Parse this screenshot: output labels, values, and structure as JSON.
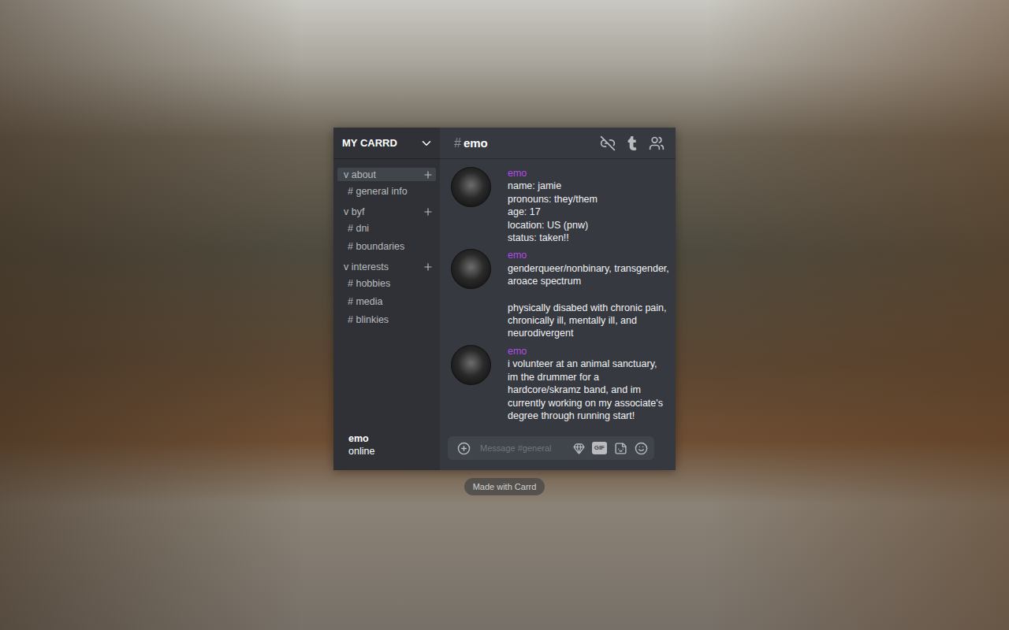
{
  "sidebar": {
    "title": "MY CARRD",
    "categories": [
      {
        "label": "v about",
        "selected": true,
        "channels": [
          "# general info"
        ]
      },
      {
        "label": "v byf",
        "selected": false,
        "channels": [
          "# dni",
          "# boundaries"
        ]
      },
      {
        "label": "v interests",
        "selected": false,
        "channels": [
          "# hobbies",
          "# media",
          "# blinkies"
        ]
      }
    ],
    "user": {
      "name": "emo",
      "status": "online"
    }
  },
  "header": {
    "hash": "#",
    "channel": "emo"
  },
  "messages": [
    {
      "author": "emo",
      "paragraphs": [
        [
          "name: jamie",
          "pronouns: they/them",
          "age: 17",
          "location: US (pnw)",
          "status: taken!!"
        ]
      ]
    },
    {
      "author": "emo",
      "paragraphs": [
        [
          "genderqueer/nonbinary, transgender, aroace spectrum"
        ],
        [
          "physically disabed with chronic pain, chronically ill, mentally ill, and neurodivergent"
        ]
      ]
    },
    {
      "author": "emo",
      "paragraphs": [
        [
          "i volunteer at an animal sanctuary, im the drummer for a hardcore/skramz band, and im currently working on my associate's degree through running start!"
        ]
      ]
    }
  ],
  "composer": {
    "placeholder": "Message #general",
    "gif_label": "GIF"
  },
  "badge": "Made with Carrd"
}
